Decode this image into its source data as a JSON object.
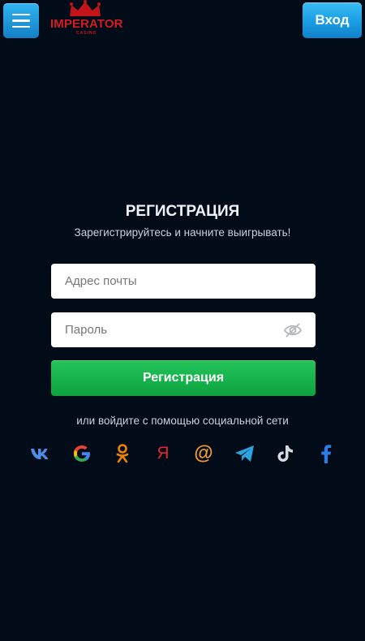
{
  "header": {
    "logo_text": "IMPERATOR",
    "logo_sub": "CASINO",
    "login_label": "Вход"
  },
  "main": {
    "title": "РЕГИСТРАЦИЯ",
    "subtitle": "Зарегистрируйтесь и начните выигрывать!",
    "email_placeholder": "Адрес почты",
    "email_value": "",
    "password_placeholder": "Пароль",
    "password_value": "",
    "register_label": "Регистрация",
    "social_caption": "или войдите с помощью социальной сети"
  },
  "social": [
    "vk-icon",
    "google-icon",
    "odnoklassniki-icon",
    "yandex-icon",
    "mail-ru-icon",
    "telegram-icon",
    "tiktok-icon",
    "facebook-icon"
  ],
  "colors": {
    "background": "#020c19",
    "accent_blue": "#1ba0e6",
    "accent_green": "#17b24c",
    "logo_red": "#d41b22"
  }
}
